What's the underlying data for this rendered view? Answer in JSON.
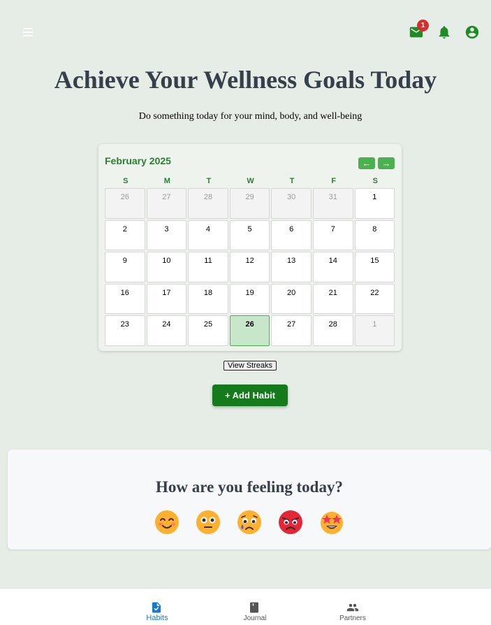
{
  "header": {
    "notification_count": "1",
    "icons": [
      "menu-icon",
      "mail-icon",
      "bell-icon",
      "account-icon"
    ],
    "accent_color": "#1f8a26"
  },
  "hero": {
    "title": "Achieve Your Wellness Goals Today",
    "subtitle": "Do something today for your mind, body, and well-being"
  },
  "calendar": {
    "month_label": "February 2025",
    "prev_label": "←",
    "next_label": "→",
    "weekdays": [
      "S",
      "M",
      "T",
      "W",
      "T",
      "F",
      "S"
    ],
    "days": [
      {
        "label": "26",
        "muted": true
      },
      {
        "label": "27",
        "muted": true
      },
      {
        "label": "28",
        "muted": true
      },
      {
        "label": "29",
        "muted": true
      },
      {
        "label": "30",
        "muted": true
      },
      {
        "label": "31",
        "muted": true
      },
      {
        "label": "1"
      },
      {
        "label": "2"
      },
      {
        "label": "3"
      },
      {
        "label": "4"
      },
      {
        "label": "5"
      },
      {
        "label": "6"
      },
      {
        "label": "7"
      },
      {
        "label": "8"
      },
      {
        "label": "9"
      },
      {
        "label": "10"
      },
      {
        "label": "11"
      },
      {
        "label": "12"
      },
      {
        "label": "13"
      },
      {
        "label": "14"
      },
      {
        "label": "15"
      },
      {
        "label": "16"
      },
      {
        "label": "17"
      },
      {
        "label": "18"
      },
      {
        "label": "19"
      },
      {
        "label": "20"
      },
      {
        "label": "21"
      },
      {
        "label": "22"
      },
      {
        "label": "23"
      },
      {
        "label": "24"
      },
      {
        "label": "25"
      },
      {
        "label": "26",
        "today": true
      },
      {
        "label": "27"
      },
      {
        "label": "28"
      },
      {
        "label": "1",
        "muted": true
      }
    ]
  },
  "actions": {
    "streaks_label": "View Streaks",
    "add_habit_label": "+ Add Habit"
  },
  "mood": {
    "title": "How are you feeling today?",
    "emojis": [
      "smiling-face-icon",
      "neutral-face-icon",
      "crying-face-icon",
      "angry-face-icon",
      "star-struck-face-icon"
    ]
  },
  "bottom_nav": {
    "items": [
      {
        "label": "Habits",
        "icon": "habits-icon",
        "active": true
      },
      {
        "label": "Journal",
        "icon": "journal-icon"
      },
      {
        "label": "Partners",
        "icon": "partners-icon"
      }
    ]
  }
}
